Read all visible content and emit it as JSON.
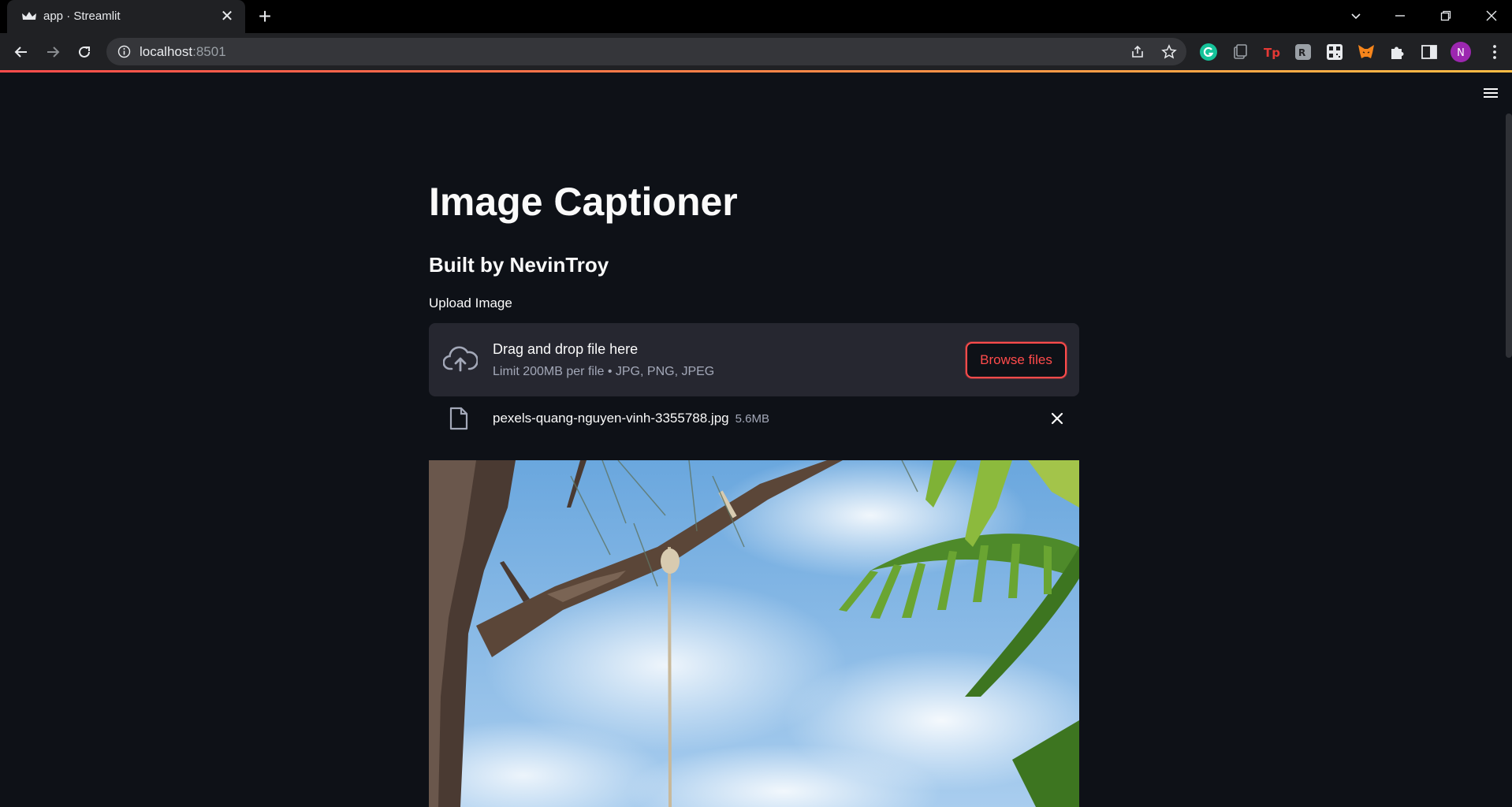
{
  "browser": {
    "tab": {
      "title": "app · Streamlit",
      "favicon": "streamlit-crown-icon"
    },
    "address_bar": {
      "host": "localhost",
      "port": ":8501"
    },
    "extensions": [
      "grammarly-icon",
      "clipboard-icon",
      "tp-icon",
      "translate-icon",
      "qr-icon",
      "metamask-fox-icon",
      "puzzle-icon",
      "side-panel-icon"
    ],
    "profile_initial": "N",
    "colors": {
      "accent_start": "#ff4b4b",
      "accent_end": "#ffbd45",
      "profile": "#9c27b0"
    }
  },
  "app": {
    "title": "Image Captioner",
    "subtitle": "Built by NevinTroy",
    "upload": {
      "label": "Upload Image",
      "drop_title": "Drag and drop file here",
      "drop_limit": "Limit 200MB per file • JPG, PNG, JPEG",
      "browse_label": "Browse files"
    },
    "file": {
      "name": "pexels-quang-nguyen-vinh-3355788.jpg",
      "size": "5.6MB"
    },
    "image_description": "tree-branch-rope-palm-sky-photo",
    "colors": {
      "primary": "#ff4b4b",
      "background": "#0e1117",
      "secondary_bg": "#262730",
      "text": "#fafafa"
    }
  }
}
